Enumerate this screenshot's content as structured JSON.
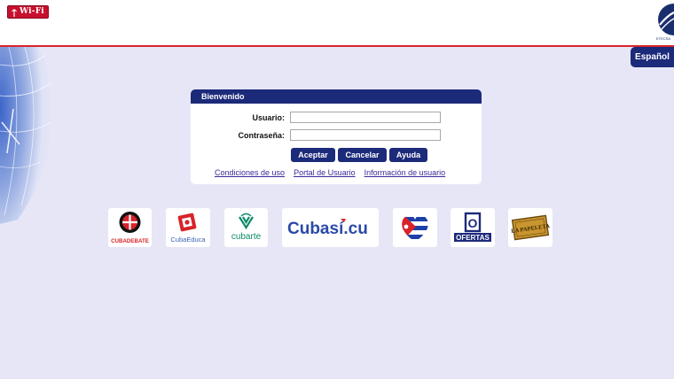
{
  "header": {
    "wifi_logo_text": "Wi-Fi",
    "etecsa_caption": "ETECSA",
    "language_button": "Español"
  },
  "login": {
    "title": "Bienvenido",
    "username_label": "Usuario:",
    "username_value": "",
    "password_label": "Contraseña:",
    "password_value": "",
    "buttons": {
      "accept": "Aceptar",
      "cancel": "Cancelar",
      "help": "Ayuda"
    },
    "links": {
      "terms": "Condiciones de uso",
      "portal": "Portal de Usuario",
      "info": "Información de usuario"
    }
  },
  "partners": {
    "cubadebate": "CUBADEBATE",
    "cubaeduca": "CubaEduca",
    "cubarte": "cubarte",
    "cubasi": "Cubasí.cu",
    "ofertas": "OFERTAS",
    "ofertas_letter": "O",
    "papeleta": "LA PAPELETA"
  },
  "colors": {
    "brand_navy": "#1c2a7a",
    "header_line": "#d8232a",
    "background": "#e6e6f7",
    "link": "#3a2a9a"
  }
}
